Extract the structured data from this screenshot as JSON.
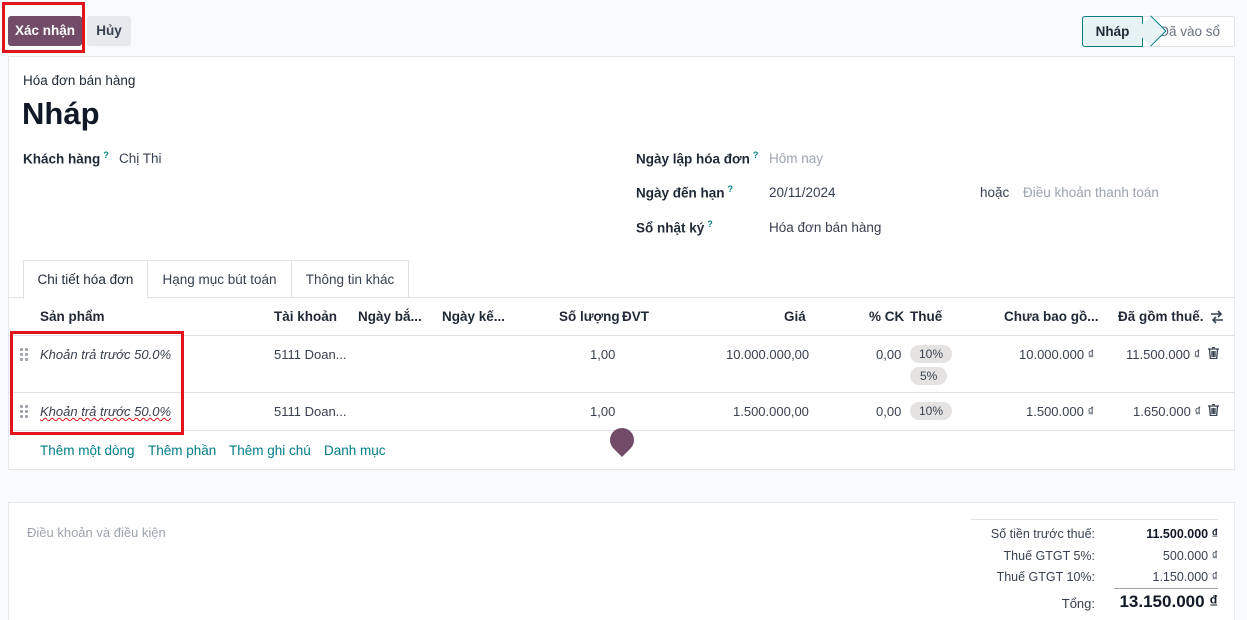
{
  "actions": {
    "confirm_label": "Xác nhận",
    "cancel_label": "Hủy"
  },
  "status_bar": {
    "current": "Nháp",
    "next": "Đã vào sổ"
  },
  "invoice": {
    "type_label": "Hóa đơn bán hàng",
    "title": "Nháp",
    "customer_label": "Khách hàng",
    "customer_value": "Chị Thi",
    "invoice_date_label": "Ngày lập hóa đơn",
    "invoice_date_placeholder": "Hôm nay",
    "due_date_label": "Ngày đến hạn",
    "due_date_value": "20/11/2024",
    "or_label": "hoặc",
    "payment_terms_placeholder": "Điều khoản thanh toán",
    "journal_label": "Sổ nhật ký",
    "journal_value": "Hóa đơn bán hàng",
    "help_mark": "?"
  },
  "tabs": [
    "Chi tiết hóa đơn",
    "Hạng mục bút toán",
    "Thông tin khác"
  ],
  "table": {
    "headers": {
      "product": "Sản phẩm",
      "account": "Tài khoản",
      "date_start": "Ngày bắ...",
      "date_end": "Ngày kế...",
      "quantity": "Số lượng",
      "uom": "ĐVT",
      "price": "Giá",
      "discount": "% CK",
      "taxes": "Thuế",
      "subtotal": "Chưa bao gồ...",
      "total": "Đã gồm thuế."
    },
    "rows": [
      {
        "product": "Khoản trả trước 50.0%",
        "account": "5111 Doan...",
        "quantity": "1,00",
        "price": "10.000.000,00",
        "discount": "0,00",
        "taxes": [
          "10%",
          "5%"
        ],
        "subtotal": "10.000.000 ₫",
        "total": "11.500.000 ₫"
      },
      {
        "product": "Khoản trả trước 50.0%",
        "account": "5111 Doan...",
        "quantity": "1,00",
        "price": "1.500.000,00",
        "discount": "0,00",
        "taxes": [
          "10%"
        ],
        "subtotal": "1.500.000 ₫",
        "total": "1.650.000 ₫"
      }
    ],
    "add_links": [
      "Thêm một dòng",
      "Thêm phần",
      "Thêm ghi chú",
      "Danh mục"
    ]
  },
  "terms_placeholder": "Điều khoản và điều kiện",
  "totals": {
    "untaxed_label": "Số tiền trước thuế:",
    "untaxed_value": "11.500.000 ₫",
    "vat5_label": "Thuế GTGT 5%:",
    "vat5_value": "500.000 ₫",
    "vat10_label": "Thuế GTGT 10%:",
    "vat10_value": "1.150.000 ₫",
    "total_label": "Tổng:",
    "total_value": "13.150.000 ₫"
  },
  "colors": {
    "primary": "#714b67",
    "link": "#017e84",
    "highlight": "#e1141c"
  },
  "icons": [
    "drag-handle-icon",
    "trash-icon",
    "column-settings-icon",
    "help-icon"
  ]
}
